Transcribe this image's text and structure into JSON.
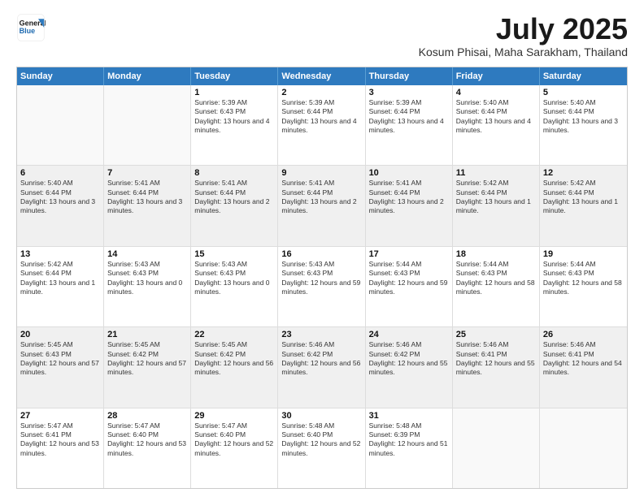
{
  "header": {
    "logo_line1": "General",
    "logo_line2": "Blue",
    "title": "July 2025",
    "subtitle": "Kosum Phisai, Maha Sarakham, Thailand"
  },
  "calendar": {
    "days_of_week": [
      "Sunday",
      "Monday",
      "Tuesday",
      "Wednesday",
      "Thursday",
      "Friday",
      "Saturday"
    ],
    "weeks": [
      [
        {
          "day": "",
          "empty": true
        },
        {
          "day": "",
          "empty": true
        },
        {
          "day": "1",
          "sunrise": "5:39 AM",
          "sunset": "6:43 PM",
          "daylight": "13 hours and 4 minutes."
        },
        {
          "day": "2",
          "sunrise": "5:39 AM",
          "sunset": "6:44 PM",
          "daylight": "13 hours and 4 minutes."
        },
        {
          "day": "3",
          "sunrise": "5:39 AM",
          "sunset": "6:44 PM",
          "daylight": "13 hours and 4 minutes."
        },
        {
          "day": "4",
          "sunrise": "5:40 AM",
          "sunset": "6:44 PM",
          "daylight": "13 hours and 4 minutes."
        },
        {
          "day": "5",
          "sunrise": "5:40 AM",
          "sunset": "6:44 PM",
          "daylight": "13 hours and 3 minutes."
        }
      ],
      [
        {
          "day": "6",
          "sunrise": "5:40 AM",
          "sunset": "6:44 PM",
          "daylight": "13 hours and 3 minutes."
        },
        {
          "day": "7",
          "sunrise": "5:41 AM",
          "sunset": "6:44 PM",
          "daylight": "13 hours and 3 minutes."
        },
        {
          "day": "8",
          "sunrise": "5:41 AM",
          "sunset": "6:44 PM",
          "daylight": "13 hours and 2 minutes."
        },
        {
          "day": "9",
          "sunrise": "5:41 AM",
          "sunset": "6:44 PM",
          "daylight": "13 hours and 2 minutes."
        },
        {
          "day": "10",
          "sunrise": "5:41 AM",
          "sunset": "6:44 PM",
          "daylight": "13 hours and 2 minutes."
        },
        {
          "day": "11",
          "sunrise": "5:42 AM",
          "sunset": "6:44 PM",
          "daylight": "13 hours and 1 minute."
        },
        {
          "day": "12",
          "sunrise": "5:42 AM",
          "sunset": "6:44 PM",
          "daylight": "13 hours and 1 minute."
        }
      ],
      [
        {
          "day": "13",
          "sunrise": "5:42 AM",
          "sunset": "6:44 PM",
          "daylight": "13 hours and 1 minute."
        },
        {
          "day": "14",
          "sunrise": "5:43 AM",
          "sunset": "6:43 PM",
          "daylight": "13 hours and 0 minutes."
        },
        {
          "day": "15",
          "sunrise": "5:43 AM",
          "sunset": "6:43 PM",
          "daylight": "13 hours and 0 minutes."
        },
        {
          "day": "16",
          "sunrise": "5:43 AM",
          "sunset": "6:43 PM",
          "daylight": "12 hours and 59 minutes."
        },
        {
          "day": "17",
          "sunrise": "5:44 AM",
          "sunset": "6:43 PM",
          "daylight": "12 hours and 59 minutes."
        },
        {
          "day": "18",
          "sunrise": "5:44 AM",
          "sunset": "6:43 PM",
          "daylight": "12 hours and 58 minutes."
        },
        {
          "day": "19",
          "sunrise": "5:44 AM",
          "sunset": "6:43 PM",
          "daylight": "12 hours and 58 minutes."
        }
      ],
      [
        {
          "day": "20",
          "sunrise": "5:45 AM",
          "sunset": "6:43 PM",
          "daylight": "12 hours and 57 minutes."
        },
        {
          "day": "21",
          "sunrise": "5:45 AM",
          "sunset": "6:42 PM",
          "daylight": "12 hours and 57 minutes."
        },
        {
          "day": "22",
          "sunrise": "5:45 AM",
          "sunset": "6:42 PM",
          "daylight": "12 hours and 56 minutes."
        },
        {
          "day": "23",
          "sunrise": "5:46 AM",
          "sunset": "6:42 PM",
          "daylight": "12 hours and 56 minutes."
        },
        {
          "day": "24",
          "sunrise": "5:46 AM",
          "sunset": "6:42 PM",
          "daylight": "12 hours and 55 minutes."
        },
        {
          "day": "25",
          "sunrise": "5:46 AM",
          "sunset": "6:41 PM",
          "daylight": "12 hours and 55 minutes."
        },
        {
          "day": "26",
          "sunrise": "5:46 AM",
          "sunset": "6:41 PM",
          "daylight": "12 hours and 54 minutes."
        }
      ],
      [
        {
          "day": "27",
          "sunrise": "5:47 AM",
          "sunset": "6:41 PM",
          "daylight": "12 hours and 53 minutes."
        },
        {
          "day": "28",
          "sunrise": "5:47 AM",
          "sunset": "6:40 PM",
          "daylight": "12 hours and 53 minutes."
        },
        {
          "day": "29",
          "sunrise": "5:47 AM",
          "sunset": "6:40 PM",
          "daylight": "12 hours and 52 minutes."
        },
        {
          "day": "30",
          "sunrise": "5:48 AM",
          "sunset": "6:40 PM",
          "daylight": "12 hours and 52 minutes."
        },
        {
          "day": "31",
          "sunrise": "5:48 AM",
          "sunset": "6:39 PM",
          "daylight": "12 hours and 51 minutes."
        },
        {
          "day": "",
          "empty": true
        },
        {
          "day": "",
          "empty": true
        }
      ]
    ]
  }
}
